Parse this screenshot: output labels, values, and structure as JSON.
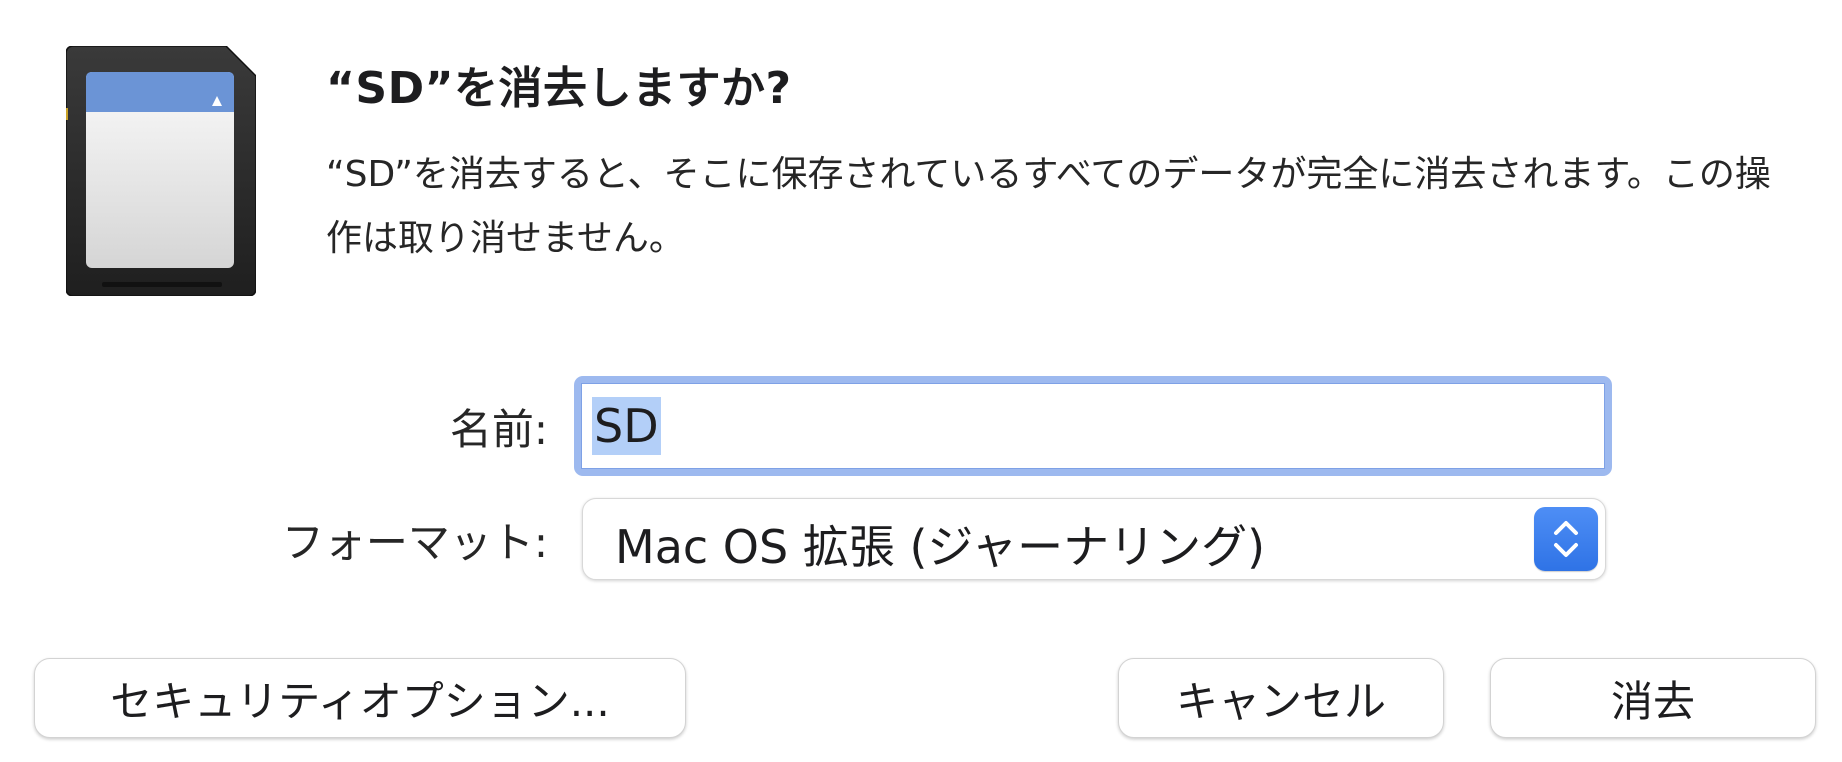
{
  "dialog": {
    "title": "“SD”を消去しますか?",
    "message": "“SD”を消去すると、そこに保存されているすべてのデータが完全に消去されます。この操作は取り消せません。"
  },
  "icons": {
    "disk": "sd-card-icon",
    "format_stepper": "chevron-up-down-icon"
  },
  "form": {
    "name_label": "名前:",
    "name_value": "SD",
    "format_label": "フォーマット:",
    "format_value": "Mac OS 拡張 (ジャーナリング)"
  },
  "buttons": {
    "security_options": "セキュリティオプション...",
    "cancel": "キャンセル",
    "erase": "消去"
  },
  "colors": {
    "accent": "#3478f6",
    "focus_ring": "#9db9ef",
    "selection": "#b3cff8"
  }
}
